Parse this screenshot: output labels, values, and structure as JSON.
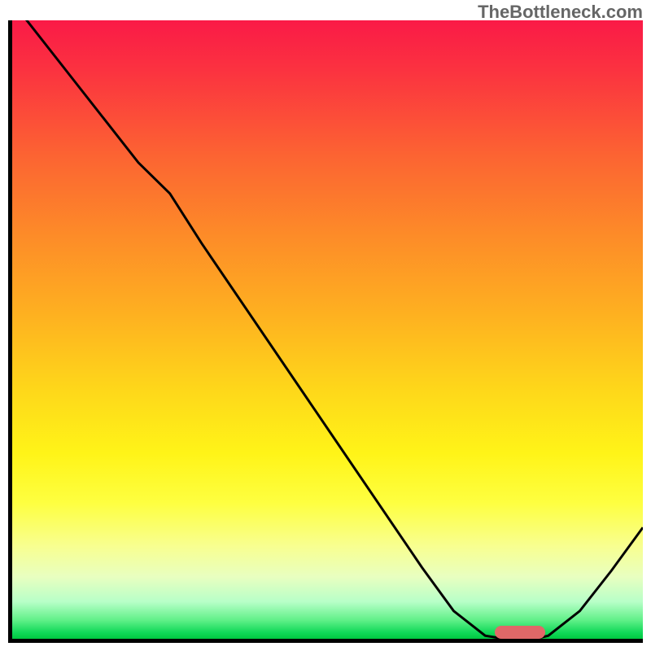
{
  "watermark": "TheBottleneck.com",
  "chart_data": {
    "type": "line",
    "title": "",
    "xlabel": "",
    "ylabel": "",
    "x": [
      0.0,
      0.1,
      0.2,
      0.25,
      0.3,
      0.35,
      0.4,
      0.45,
      0.5,
      0.55,
      0.6,
      0.65,
      0.7,
      0.75,
      0.78,
      0.8,
      0.83,
      0.85,
      0.9,
      0.95,
      1.0
    ],
    "y": [
      1.03,
      0.9,
      0.77,
      0.72,
      0.64,
      0.565,
      0.49,
      0.415,
      0.34,
      0.265,
      0.19,
      0.115,
      0.045,
      0.005,
      0.0,
      0.0,
      0.0,
      0.005,
      0.045,
      0.11,
      0.18
    ],
    "xlim": [
      0,
      1
    ],
    "ylim": [
      0,
      1
    ],
    "sweet_spot": {
      "x_start": 0.76,
      "x_end": 0.84,
      "y": 0.005
    },
    "notes": "Axes unlabeled; normalized 0–1. Curve descends from top-left, steepens after ~x=0.25, bottoms out near x≈0.80 at y≈0, then rises toward x=1. Background is vertical heat gradient (red→green). Small rounded red marker at the trough."
  },
  "colors": {
    "axis": "#000000",
    "curve": "#000000",
    "marker": "#e06868",
    "watermark": "#666666"
  }
}
